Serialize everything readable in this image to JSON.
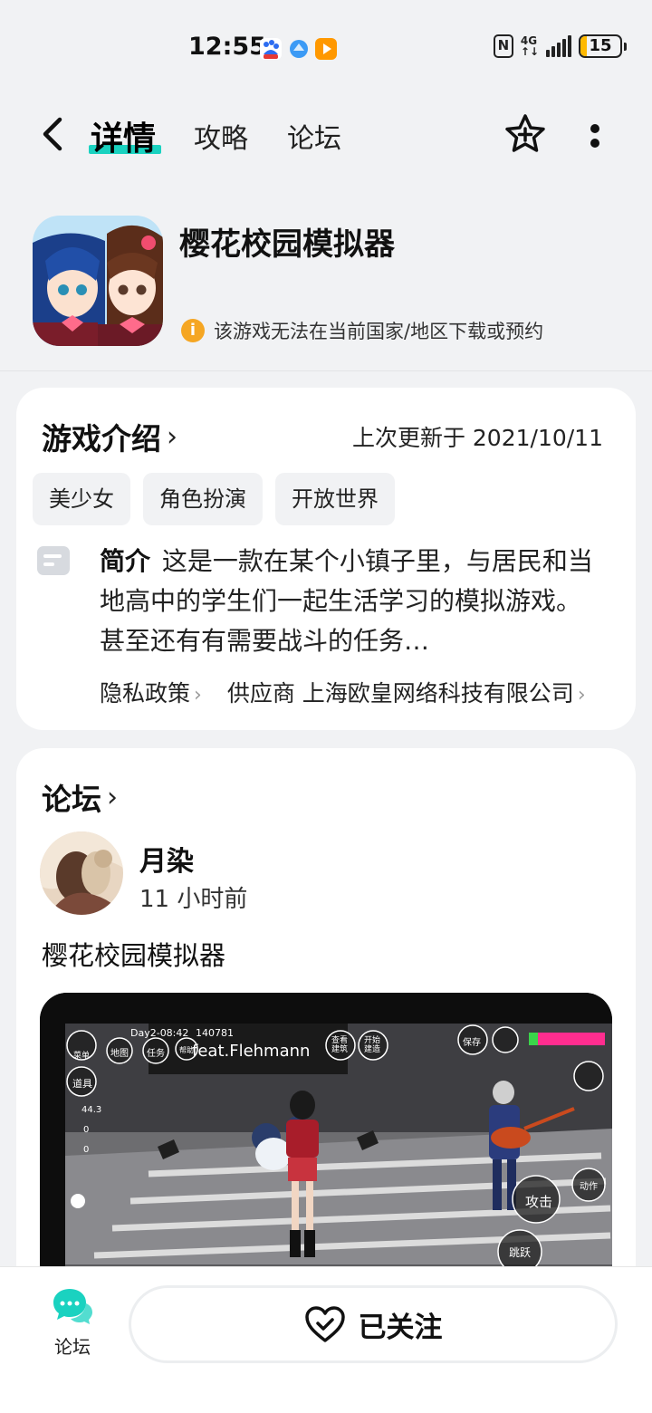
{
  "status_bar": {
    "time": "12:55",
    "network": "4G",
    "battery": "15",
    "battery_level": 0.15,
    "battery_color": "#ffb900",
    "icons": [
      "baidu-app-icon",
      "browser-app-icon",
      "video-app-icon",
      "nfc-icon",
      "signal-icon",
      "battery-icon"
    ]
  },
  "nav": {
    "back_icon": "chevron-left-icon",
    "tabs": [
      {
        "label": "详情",
        "active": true
      },
      {
        "label": "攻略",
        "active": false
      },
      {
        "label": "论坛",
        "active": false
      }
    ],
    "accent_color": "#1ad2c0",
    "star_icon": "star-plus-icon",
    "more_icon": "more-vertical-icon"
  },
  "game": {
    "title": "樱花校园模拟器",
    "notice": "该游戏无法在当前国家/地区下载或预约",
    "notice_icon": "info-icon"
  },
  "intro": {
    "section_title": "游戏介绍",
    "updated": "上次更新于 2021/10/11",
    "tags": [
      "美少女",
      "角色扮演",
      "开放世界"
    ],
    "desc_label": "简介",
    "desc_text": "这是一款在某个小镇子里，与居民和当地高中的学生们一起生活学习的模拟游戏。 甚至还有有需要战斗的任务…",
    "privacy": "隐私政策",
    "supplier_label": "供应商",
    "supplier_name": "上海欧皇网络科技有限公司"
  },
  "forum": {
    "section_title": "论坛",
    "author": "月染",
    "time": "11 小时前",
    "post_text": "樱花校园模拟器",
    "game_hud": {
      "day_time": "Day2-08:42",
      "score": "140781",
      "stage_banner": "feat.Flehmann",
      "menu": "菜单",
      "items": "道具",
      "map": "地图",
      "task": "任务",
      "help": "帮助",
      "check": "查看建筑",
      "start": "开始建造",
      "save": "保存",
      "attack": "攻击",
      "jump": "跳跃",
      "action": "动作",
      "stat_value": "44.3",
      "zero_a": "0",
      "zero_b": "0"
    }
  },
  "bottom": {
    "forum_tab_label": "论坛",
    "follow_label": "已关注",
    "heart_icon": "heart-check-icon",
    "forum_icon": "chat-bubbles-icon"
  }
}
